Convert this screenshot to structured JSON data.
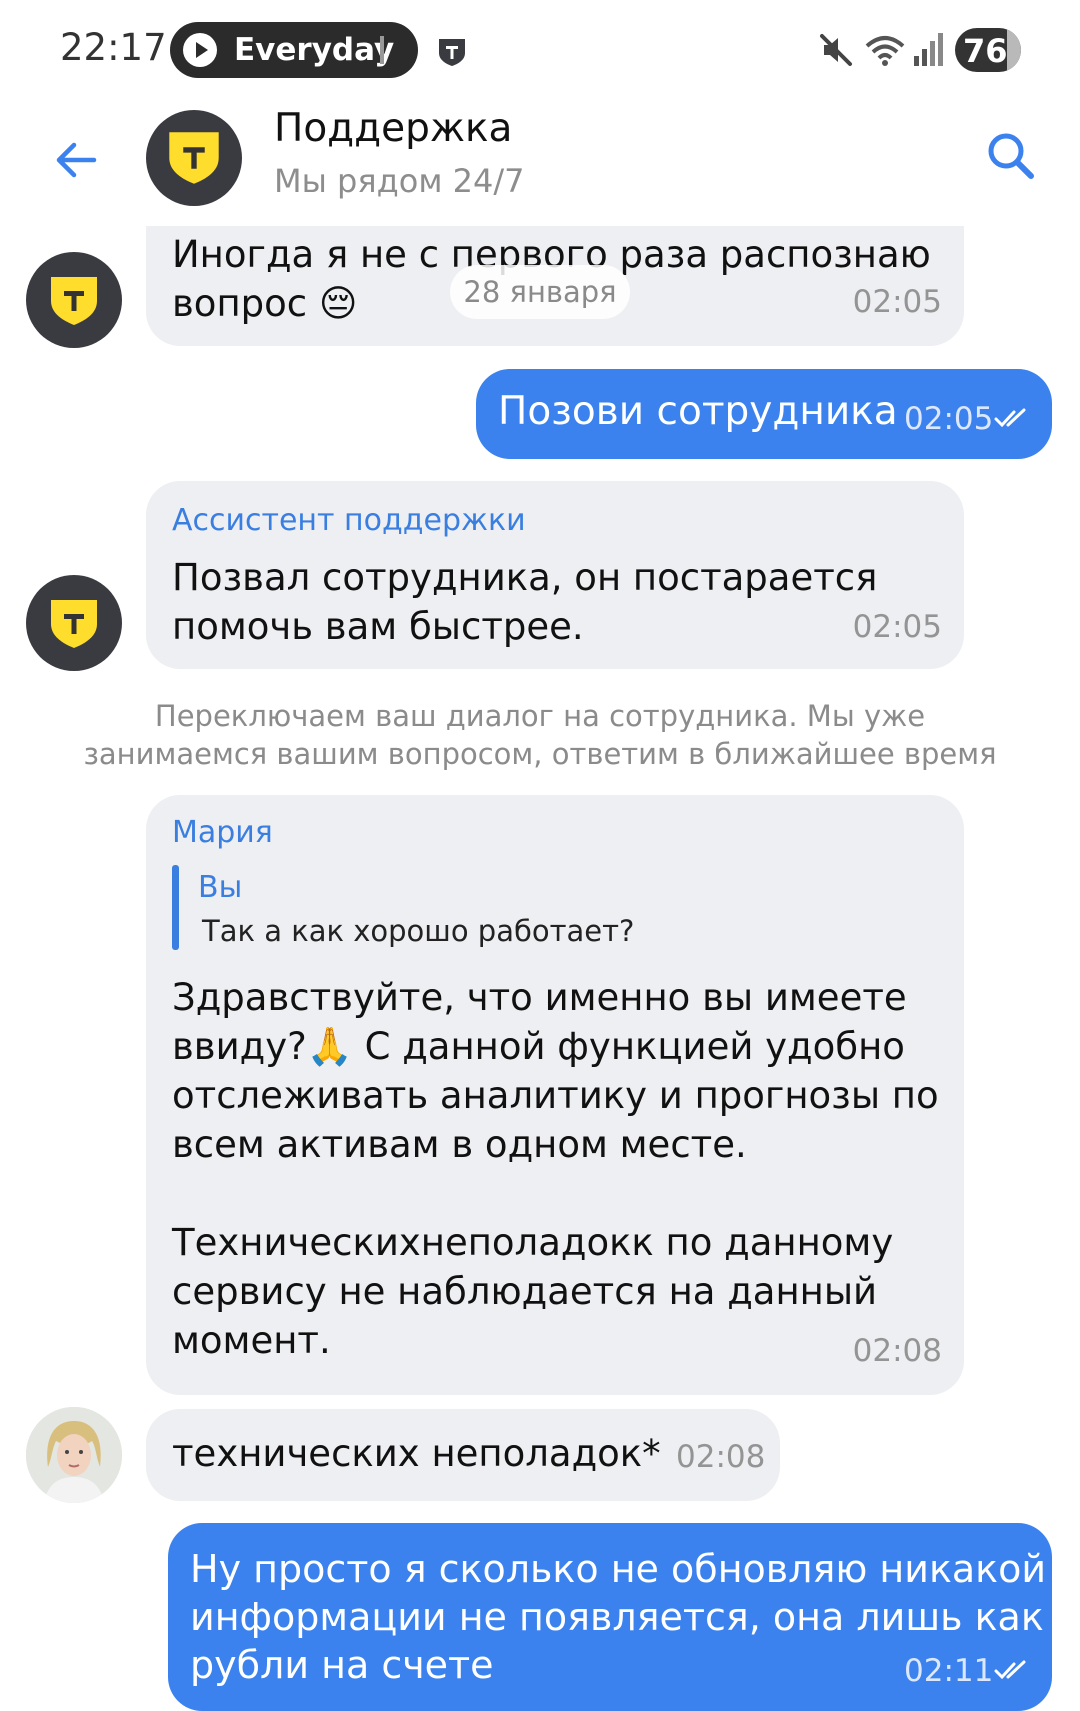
{
  "status_bar": {
    "time": "22:17",
    "media_label": "Everyday",
    "battery": "76",
    "icons": [
      "play-icon",
      "shield-icon",
      "mute-icon",
      "wifi-icon",
      "signal-icon",
      "battery-icon"
    ]
  },
  "header": {
    "title": "Поддержка",
    "subtitle": "Мы рядом 24/7",
    "avatar_letter": "T",
    "icons": [
      "back-arrow-icon",
      "search-icon"
    ]
  },
  "colors": {
    "accent": "#3b82ee",
    "incoming_bubble": "#eeeff2",
    "brand_yellow": "#ffdd2d",
    "brand_dark": "#3a3b40"
  },
  "chat": {
    "date_chip": "28 января",
    "messages": [
      {
        "direction": "in",
        "sender": "",
        "text": "Иногда я не с первого раза распознаю\nвопрос 😔",
        "time": "02:05"
      },
      {
        "direction": "out",
        "text": "Позови сотрудника",
        "time": "02:05",
        "read": true
      },
      {
        "direction": "in",
        "sender": "Ассистент поддержки",
        "text": "Позвал сотрудника, он постарается\nпомочь вам быстрее.",
        "time": "02:05"
      },
      {
        "direction": "in",
        "sender": "Мария",
        "quote": {
          "author": "Вы",
          "text": "Так а как хорошо работает?"
        },
        "text": "Здравствуйте, что именно вы имеете\nввиду?🙏 С данной функцией удобно\nотслеживать аналитику и прогнозы по\nвсем активам в одном месте.\n\nТехническихнеполадокк по данному\nсервису не наблюдается на данный\nмомент.",
        "time": "02:08"
      },
      {
        "direction": "in",
        "sender": "",
        "text": "технических неполадок*",
        "time": "02:08"
      },
      {
        "direction": "out",
        "text": "Ну просто я сколько не обновляю никакой\nинформации не появляется, она лишь как\nрубли на счете",
        "time": "02:11",
        "read": true
      }
    ],
    "system_note": "Переключаем ваш диалог на сотрудника. Мы уже\nзанимаемся вашим вопросом, ответим в ближайшее время"
  }
}
